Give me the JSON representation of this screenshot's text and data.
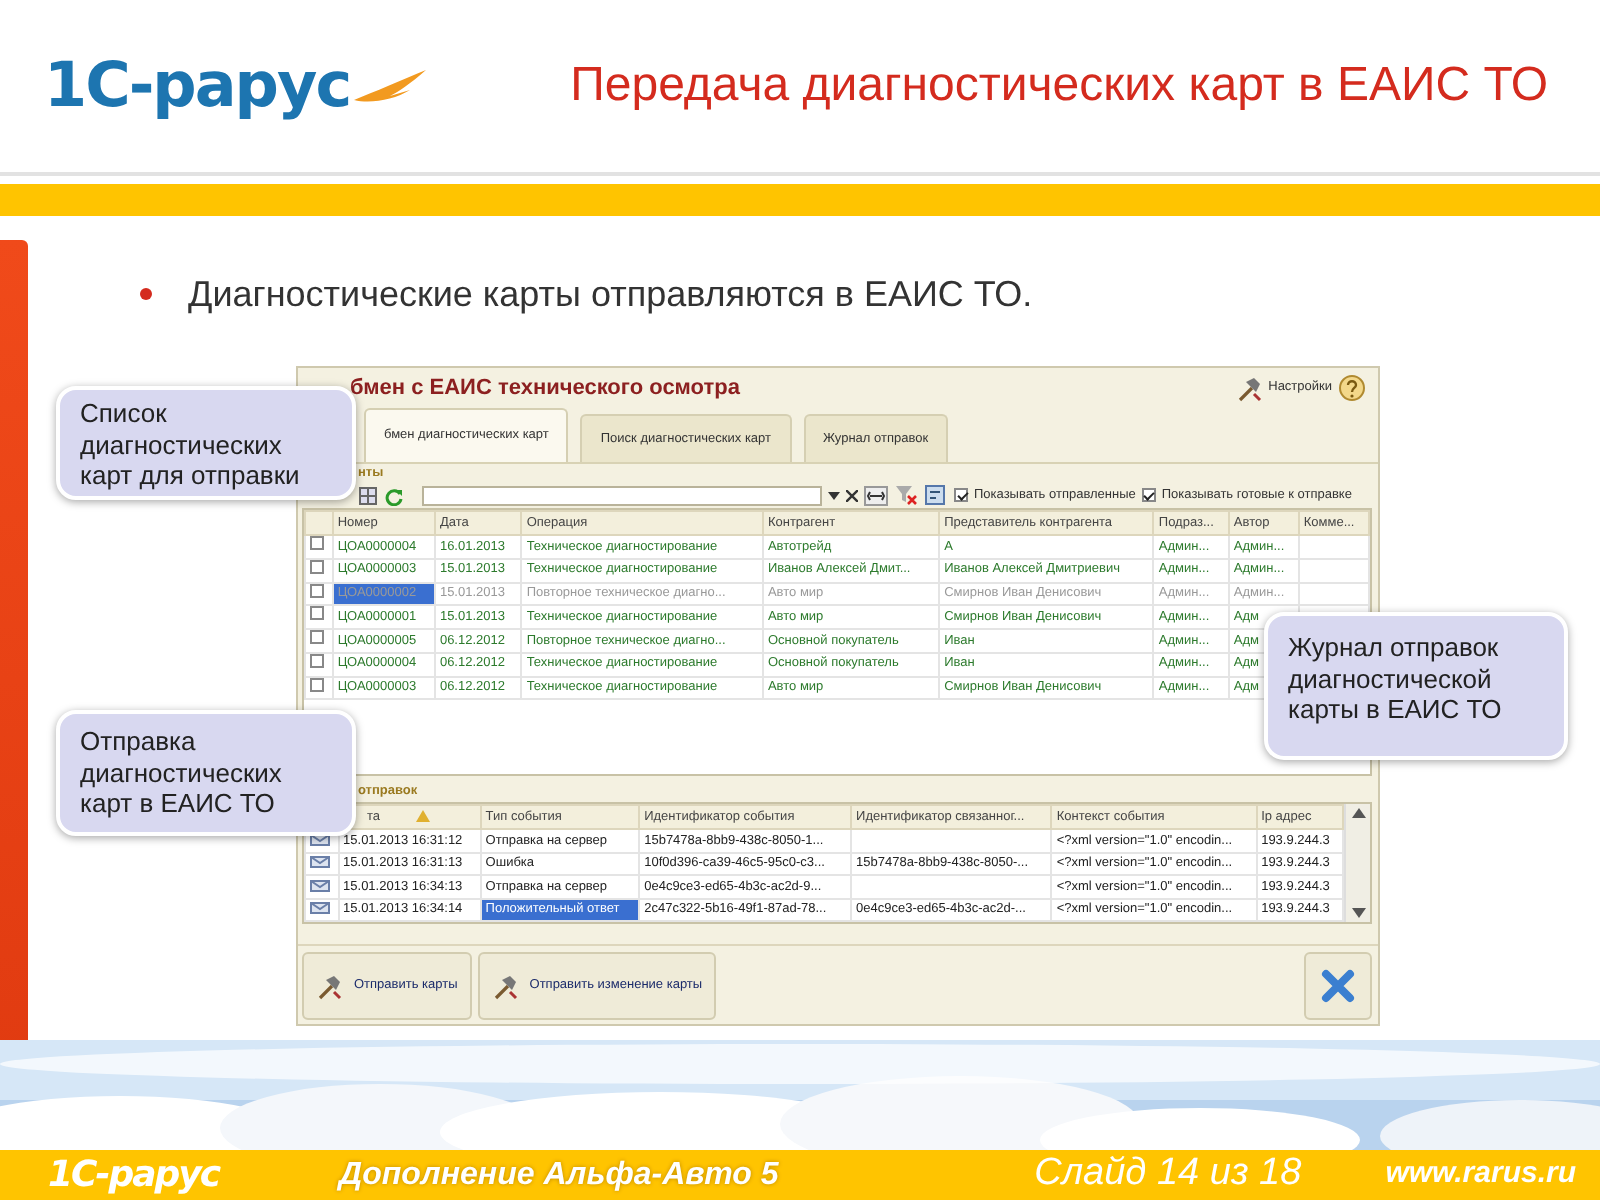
{
  "slide": {
    "logo": "1С-рарус",
    "title": "Передача диагностических карт в ЕАИС ТО",
    "bullets": [
      "Диагностические карты отправляются в ЕАИС ТО."
    ]
  },
  "window": {
    "title": "бмен с ЕАИС технического осмотра",
    "settings_label": "Настройки",
    "tabs": [
      {
        "label": "бмен диагностических карт",
        "selected": true
      },
      {
        "label": "Поиск диагностических карт",
        "selected": false
      },
      {
        "label": "Журнал отправок",
        "selected": false
      }
    ],
    "cards_label": "нты",
    "filters": [
      {
        "label": "Показывать отправленные",
        "checked": true
      },
      {
        "label": "Показывать готовые к отправке",
        "checked": true
      }
    ],
    "table": {
      "columns": [
        "Номер",
        "Дата",
        "Операция",
        "Контрагент",
        "Представитель контрагента",
        "Подраз...",
        "Автор",
        "Комме..."
      ],
      "rows": [
        {
          "checked": false,
          "selected": false,
          "greyed": false,
          "cells": [
            "ЦОА0000004",
            "16.01.2013",
            "Техническое диагностирование",
            "Автотрейд",
            "А",
            "Админ...",
            "Админ..."
          ]
        },
        {
          "checked": false,
          "selected": false,
          "greyed": false,
          "cells": [
            "ЦОА0000003",
            "15.01.2013",
            "Техническое диагностирование",
            "Иванов Алексей Дмит...",
            "Иванов Алексей Дмитриевич",
            "Админ...",
            "Админ..."
          ]
        },
        {
          "checked": false,
          "selected": true,
          "greyed": true,
          "cells": [
            "ЦОА0000002",
            "15.01.2013",
            "Повторное техническое диагно...",
            "Авто мир",
            "Смирнов Иван Денисович",
            "Админ...",
            "Админ..."
          ]
        },
        {
          "checked": false,
          "selected": false,
          "greyed": false,
          "cells": [
            "ЦОА0000001",
            "15.01.2013",
            "Техническое диагностирование",
            "Авто мир",
            "Смирнов Иван Денисович",
            "Админ...",
            "Адм"
          ]
        },
        {
          "checked": false,
          "selected": false,
          "greyed": false,
          "cells": [
            "ЦОА0000005",
            "06.12.2012",
            "Повторное техническое диагно...",
            "Основной покупатель",
            "Иван",
            "Админ...",
            "Адм"
          ]
        },
        {
          "checked": false,
          "selected": false,
          "greyed": false,
          "cells": [
            "ЦОА0000004",
            "06.12.2012",
            "Техническое диагностирование",
            "Основной покупатель",
            "Иван",
            "Админ...",
            "Адм"
          ]
        },
        {
          "checked": false,
          "selected": false,
          "greyed": false,
          "cells": [
            "ЦОА0000003",
            "06.12.2012",
            "Техническое диагностирование",
            "Авто мир",
            "Смирнов Иван Денисович",
            "Админ...",
            "Адм"
          ]
        }
      ]
    },
    "log": {
      "label": "отправок",
      "columns": [
        "та",
        "Тип события",
        "Идентификатор события",
        "Идентификатор связанног...",
        "Контекст события",
        "Ip адрес"
      ],
      "rows": [
        {
          "selected": false,
          "cells": [
            "15.01.2013 16:31:12",
            "Отправка на сервер",
            "15b7478a-8bb9-438c-8050-1...",
            null,
            "<?xml version=\"1.0\" encodin...",
            "193.9.244.3"
          ]
        },
        {
          "selected": false,
          "cells": [
            "15.01.2013 16:31:13",
            "Ошибка",
            "10f0d396-ca39-46c5-95c0-c3...",
            "15b7478a-8bb9-438c-8050-...",
            "<?xml version=\"1.0\" encodin...",
            "193.9.244.3"
          ]
        },
        {
          "selected": false,
          "cells": [
            "15.01.2013 16:34:13",
            "Отправка на сервер",
            "0e4c9ce3-ed65-4b3c-ac2d-9...",
            null,
            "<?xml version=\"1.0\" encodin...",
            "193.9.244.3"
          ]
        },
        {
          "selected": true,
          "cells": [
            "15.01.2013 16:34:14",
            "Положительный ответ",
            "2c47c322-5b16-49f1-87ad-78...",
            "0e4c9ce3-ed65-4b3c-ac2d-...",
            "<?xml version=\"1.0\" encodin...",
            "193.9.244.3"
          ]
        }
      ]
    },
    "buttons": [
      "Отправить карты",
      "Отправить изменение карты"
    ]
  },
  "callouts": [
    "Список диагностических карт для отправки",
    "Журнал отправок диагностической карты в ЕАИС ТО",
    "Отправка диагностических карт в ЕАИС ТО"
  ],
  "footer": {
    "logo": "1С-рарус",
    "subtitle": "Дополнение Альфа-Авто 5",
    "slide_number": "Слайд 14 из 18",
    "url": "www.rarus.ru"
  }
}
